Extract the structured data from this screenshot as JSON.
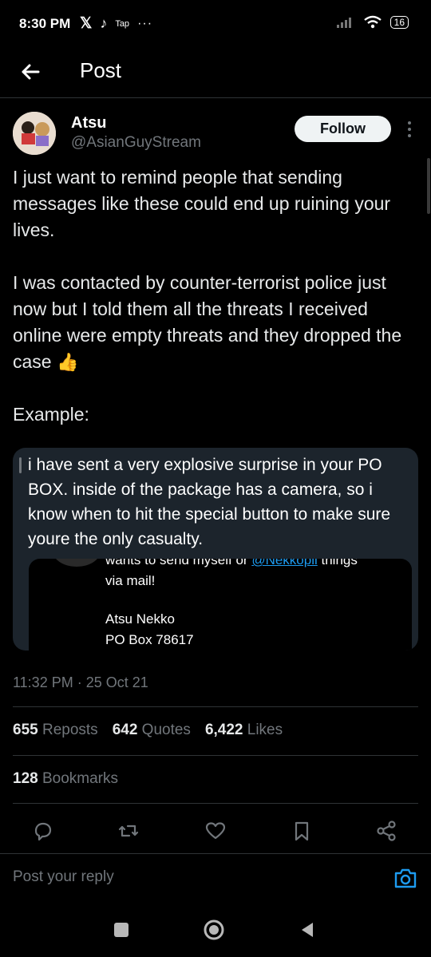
{
  "status_bar": {
    "time": "8:30 PM",
    "app_icons": [
      "x-icon",
      "tiktok-icon"
    ],
    "tap_label": "Tap",
    "more": "···",
    "battery": "16"
  },
  "topbar": {
    "title": "Post"
  },
  "post": {
    "author_name": "Atsu",
    "author_handle": "@AsianGuyStream",
    "follow_label": "Follow",
    "paragraphs": [
      "I just want to remind people that sending messages like these could end up ruining your lives.",
      "I was contacted by counter-terrorist police just now but I told them all the threats I received online were empty threats and they dropped the case",
      "Example:"
    ],
    "emoji": "👍",
    "embed_text": "i have sent a very explosive surprise in your PO BOX. inside of the package has a camera, so i know when to hit the special button to make sure youre the only casualty.",
    "inner": {
      "line1_prefix": "wants to send myself or ",
      "line1_link": "@Nekkopii",
      "line1_suffix": " things",
      "line2": "via mail!",
      "name": "Atsu Nekko",
      "box": "PO Box 78617"
    },
    "timestamp": "11:32 PM · 25 Oct 21",
    "stats": {
      "reposts_count": "655",
      "reposts_label": "Reposts",
      "quotes_count": "642",
      "quotes_label": "Quotes",
      "likes_count": "6,422",
      "likes_label": "Likes",
      "bookmarks_count": "128",
      "bookmarks_label": "Bookmarks"
    }
  },
  "reply": {
    "placeholder": "Post your reply"
  },
  "colors": {
    "accent": "#1d9bf0",
    "muted": "#71767b",
    "divider": "#2f3336",
    "embed_bg": "#1c242c"
  }
}
